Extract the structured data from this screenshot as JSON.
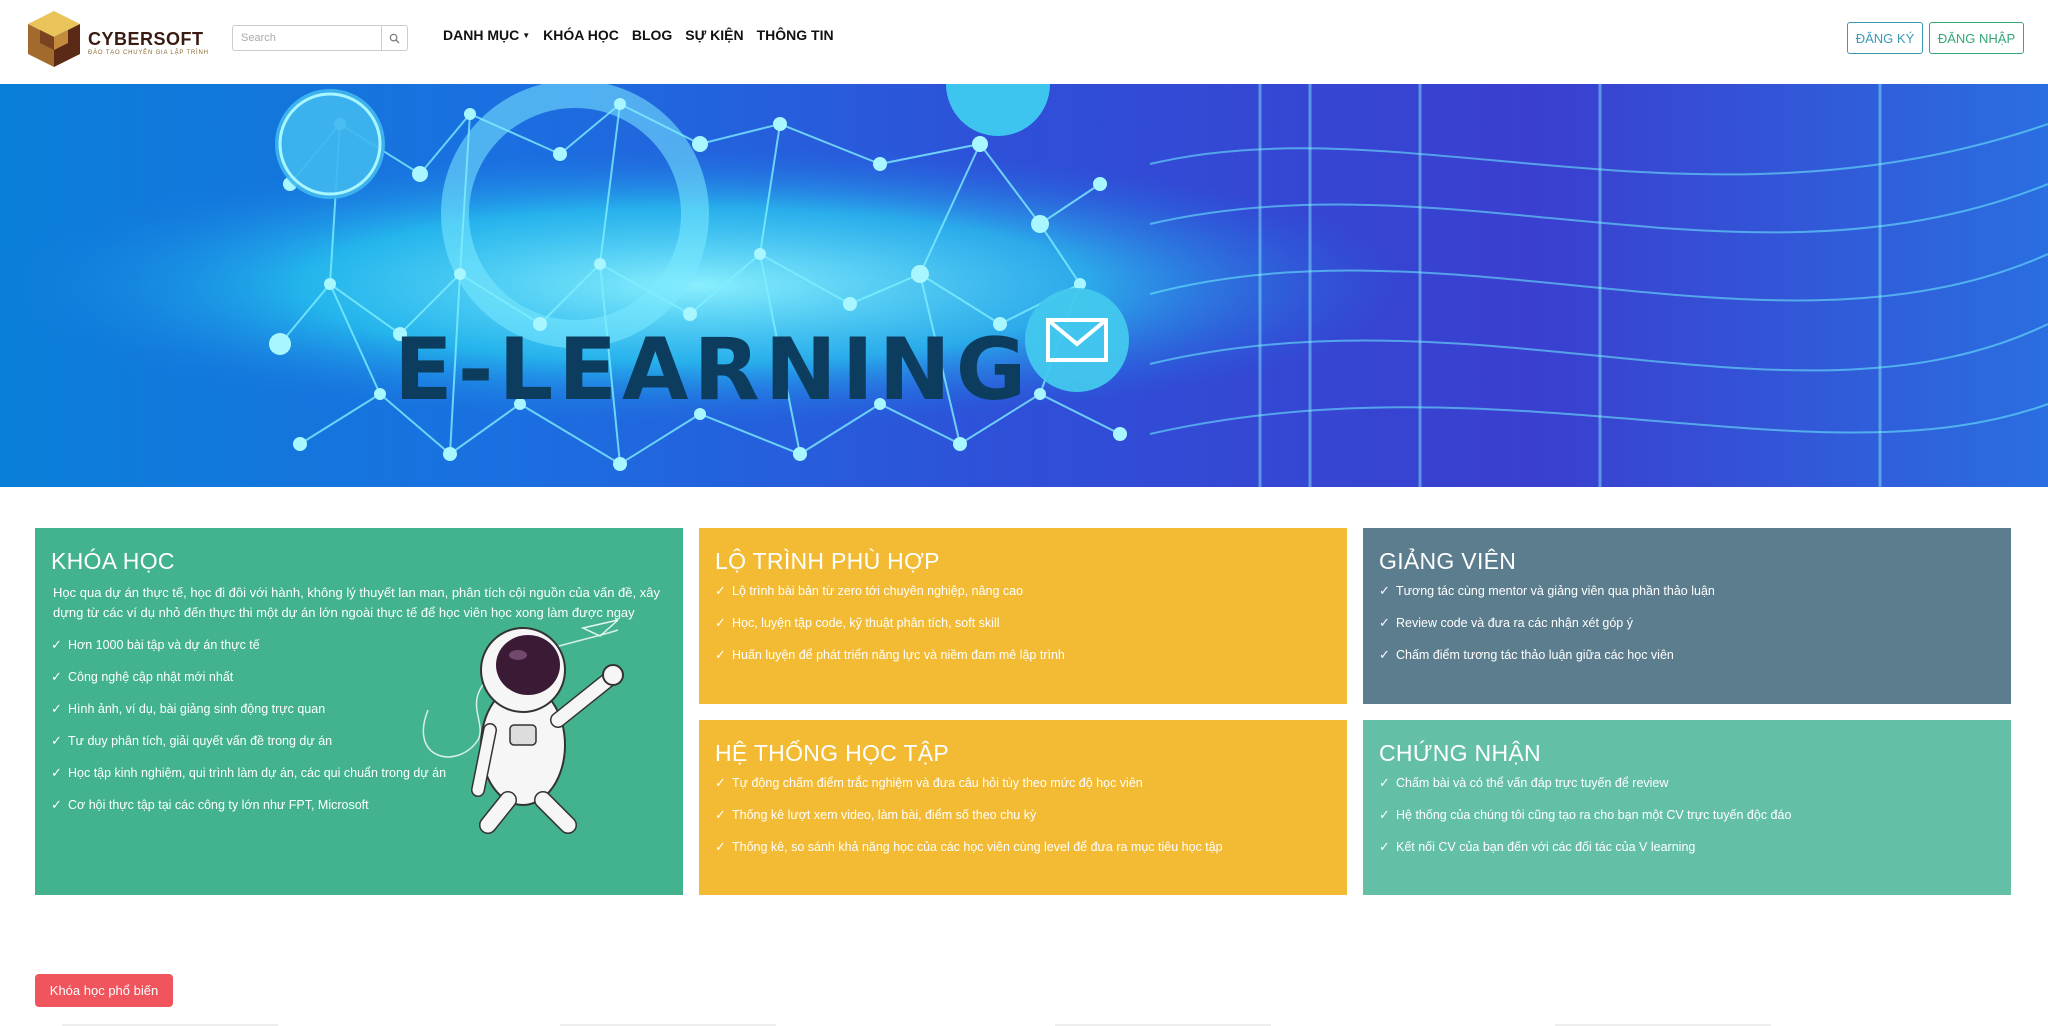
{
  "brand": {
    "name": "CYBERSOFT",
    "tagline": "ĐÀO TẠO CHUYÊN GIA LẬP TRÌNH",
    "colors": {
      "gold": "#d4a73a",
      "brown": "#3a1b12"
    }
  },
  "search": {
    "placeholder": "Search",
    "value": ""
  },
  "nav": {
    "items": [
      {
        "label": "DANH MỤC",
        "has_dropdown": true
      },
      {
        "label": "KHÓA HỌC"
      },
      {
        "label": "BLOG"
      },
      {
        "label": "SỰ KIỆN"
      },
      {
        "label": "THÔNG TIN"
      }
    ]
  },
  "auth": {
    "signup_label": "ĐĂNG KÝ",
    "login_label": "ĐĂNG NHẬP"
  },
  "banner": {
    "title": "E-LEARNING"
  },
  "cards": {
    "courses": {
      "title": "KHÓA HỌC",
      "description": "Học qua dự án thực tế, học đi đôi với hành, không lý thuyết lan man, phân tích cội nguồn của vấn đề, xây dựng từ các ví dụ nhỏ đến thực thi một dự án lớn ngoài thực tế để học viên học xong làm được ngay",
      "items": [
        "Hơn 1000 bài tập và dự án thực tế",
        "Công nghệ cập nhật mới nhất",
        "Hình ảnh, ví dụ, bài giảng sinh động trực quan",
        "Tư duy phân tích, giải quyết vấn đề trong dự án",
        "Học tập kinh nghiệm, qui trình làm dự án, các qui chuẩn trong dự án",
        "Cơ hội thực tập tại các công ty lớn như FPT, Microsoft"
      ]
    },
    "path": {
      "title": "LỘ TRÌNH PHÙ HỢP",
      "items": [
        "Lộ trình bài bản từ zero tới chuyên nghiệp, nâng cao",
        "Học, luyện tập code, kỹ thuật phân tích, soft skill",
        "Huấn luyện để phát triển năng lực và niềm đam mê lập trình"
      ]
    },
    "instructors": {
      "title": "GIẢNG VIÊN",
      "items": [
        "Tương tác cùng mentor và giảng viên qua phần thảo luận",
        "Review code và đưa ra các nhận xét góp ý",
        "Chấm điểm tương tác thảo luận giữa các học viên"
      ]
    },
    "system": {
      "title": "HỆ THỐNG HỌC TẬP",
      "items": [
        "Tự động chấm điểm trắc nghiệm và đưa câu hỏi tùy theo mức độ học viên",
        "Thống kê lượt xem video, làm bài, điểm số theo chu kỳ",
        "Thống kê, so sánh khả năng học của các học viên cùng level để đưa ra mục tiêu học tập"
      ]
    },
    "certificate": {
      "title": "CHỨNG NHẬN",
      "items": [
        "Chấm bài và có thể vấn đáp trực tuyến để review",
        "Hệ thống của chúng tôi cũng tạo ra cho bạn một CV trực tuyến độc đáo",
        "Kết nối CV của bạn đến với các đối tác của V learning"
      ]
    }
  },
  "popular": {
    "label": "Khóa học phổ biến"
  },
  "colors": {
    "green": "#42b38e",
    "yellow": "#f3bb34",
    "slate": "#5c7d8e",
    "mint": "#63c0a7",
    "red": "#f0545c"
  }
}
